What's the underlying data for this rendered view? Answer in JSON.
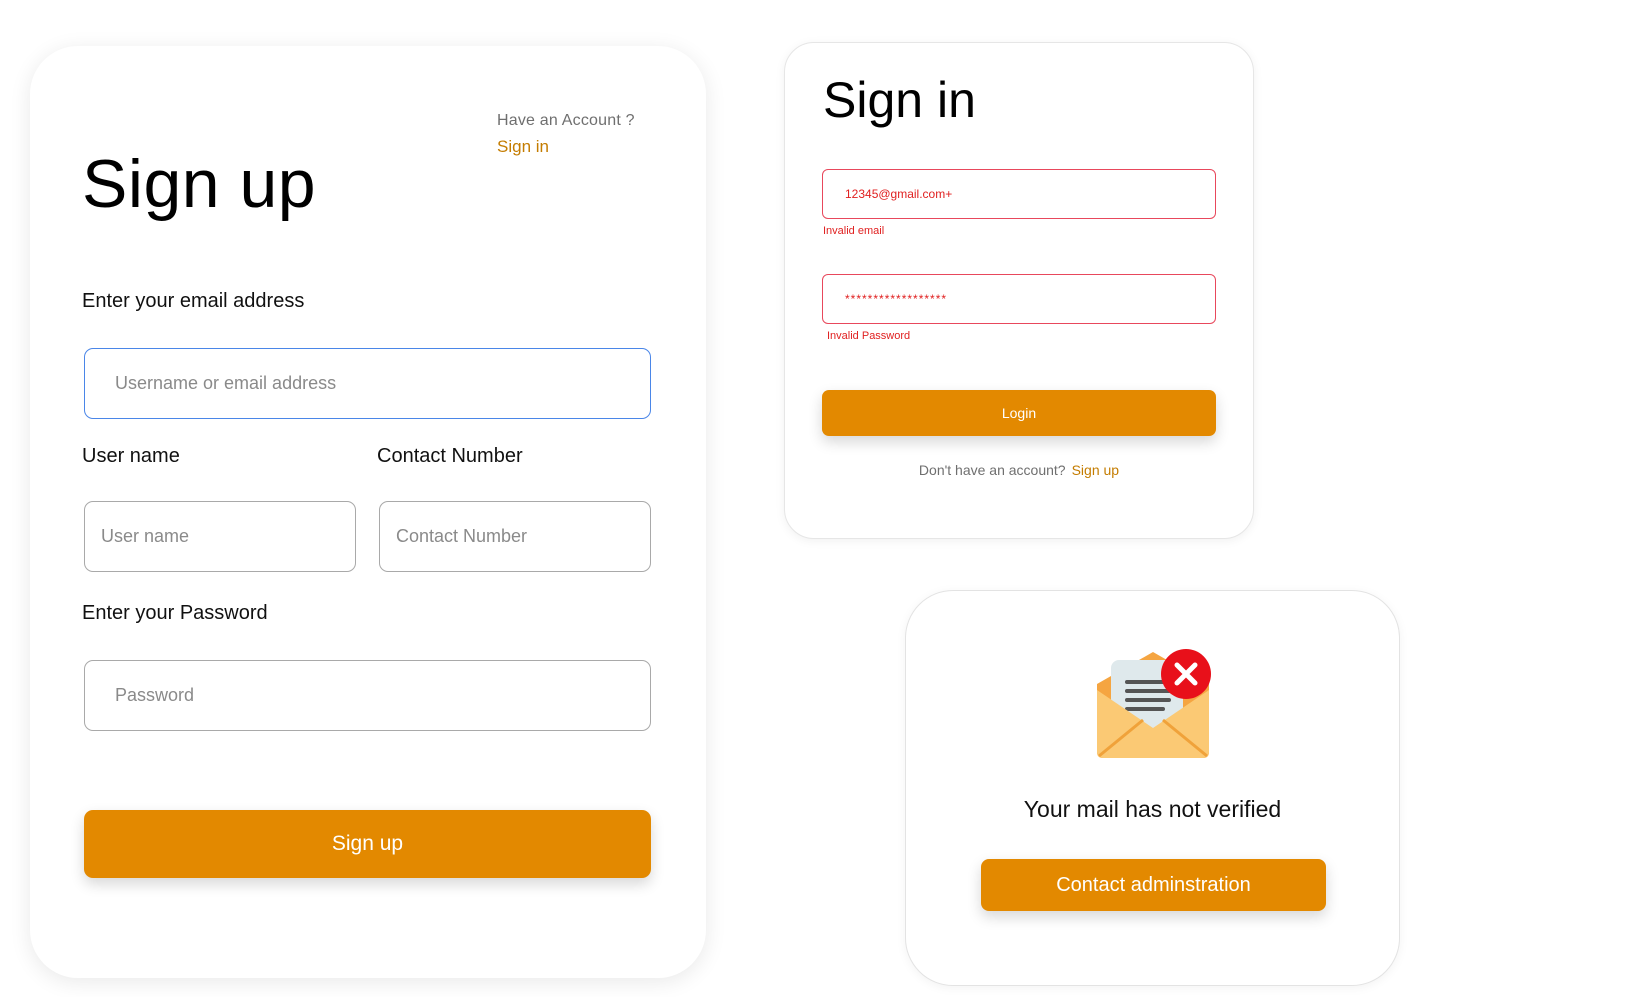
{
  "signup": {
    "have_account": "Have an Account ?",
    "signin_link": "Sign in",
    "title": "Sign up",
    "email_label": "Enter your  email address",
    "email_placeholder": "Username or email address",
    "username_label": "User name",
    "username_placeholder": "User name",
    "contact_label": "Contact Number",
    "contact_placeholder": "Contact Number",
    "password_label": "Enter your Password",
    "password_placeholder": "Password",
    "submit_label": "Sign up"
  },
  "signin": {
    "title": "Sign in",
    "email_value": "12345@gmail.com+",
    "email_error": "Invalid email",
    "password_value": "******************",
    "password_error": "Invalid Password",
    "login_label": "Login",
    "no_account_text": "Don't have an account?",
    "signup_link": "Sign up"
  },
  "verify": {
    "icon": "mail-error-icon",
    "message": "Your mail has not verified",
    "button_label": "Contact adminstration"
  },
  "colors": {
    "accent": "#e38900",
    "link": "#c47c00",
    "error": "#e02020",
    "focus_border": "#4a86e8"
  }
}
